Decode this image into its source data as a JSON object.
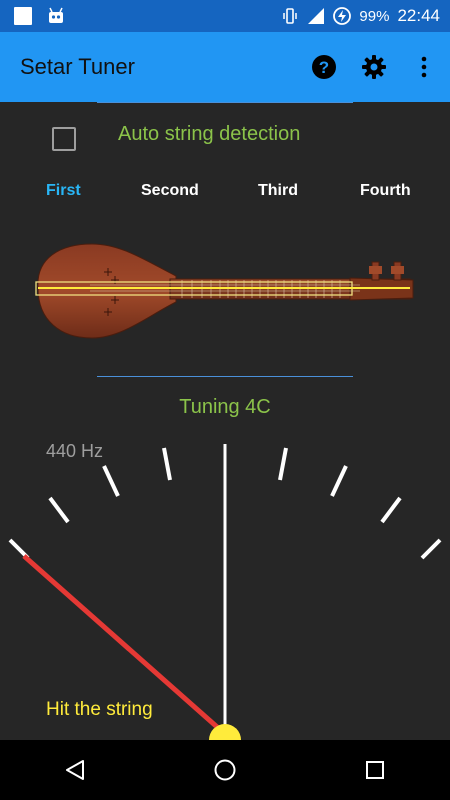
{
  "status_bar": {
    "battery_percent": "99%",
    "time": "22:44",
    "icons": [
      "notification-square-icon",
      "android-debug-icon",
      "vibrate-icon",
      "signal-icon",
      "battery-saver-icon"
    ]
  },
  "app_bar": {
    "title": "Setar Tuner",
    "actions": [
      "help-icon",
      "settings-icon",
      "overflow-menu-icon"
    ]
  },
  "auto_detect": {
    "label": "Auto string detection",
    "checked": false
  },
  "strings": {
    "tabs": [
      "First",
      "Second",
      "Third",
      "Fourth"
    ],
    "selected": "First"
  },
  "tuning": {
    "label": "Tuning 4C",
    "reference": "440 Hz",
    "hint": "Hit the string"
  },
  "colors": {
    "app_bar": "#2196F3",
    "status_bar": "#1565C0",
    "accent_green": "#8BC34A",
    "active_tab": "#29B6F6",
    "needle": "#E53935",
    "pivot": "#FFEB3B",
    "background": "#262626"
  },
  "nav_bar": {
    "buttons": [
      "back-icon",
      "home-icon",
      "recents-icon"
    ]
  }
}
